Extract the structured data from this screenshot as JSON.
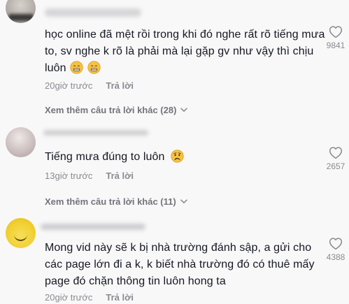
{
  "comments": [
    {
      "text_lines": [
        "học online đã mệt rồi trong khi đó nghe rất rõ tiếng mưa",
        "to, sv nghe k rõ là phải mà lại gặp gv như vậy thì chịu",
        "luôn"
      ],
      "emoji": [
        "grimace-emoji",
        "grimace-emoji"
      ],
      "time": "20giờ trước",
      "reply_label": "Trả lời",
      "likes": "9841",
      "more_replies": "Xem thêm câu trả lời khác (28)"
    },
    {
      "text_lines": [
        "Tiếng mưa đúng to luôn"
      ],
      "emoji": [
        "worried-emoji"
      ],
      "time": "13giờ trước",
      "reply_label": "Trả lời",
      "likes": "2657",
      "more_replies": "Xem thêm câu trả lời khác (11)"
    },
    {
      "text_lines": [
        "Mong vid này sẽ k bị nhà trường đánh sập, a gửi cho",
        "các page lớn đi a k, k biết nhà trường đó có thuê mấy",
        "page đó chặn thông tin luôn hong ta"
      ],
      "emoji": [],
      "time": "20giờ trước",
      "reply_label": "Trả lời",
      "likes": "4388",
      "more_replies": ""
    }
  ],
  "colors": {
    "background": "#f8f8f8",
    "text": "#161823",
    "secondary": "#8a8b91",
    "emoji_yellow": "#f6c244"
  }
}
